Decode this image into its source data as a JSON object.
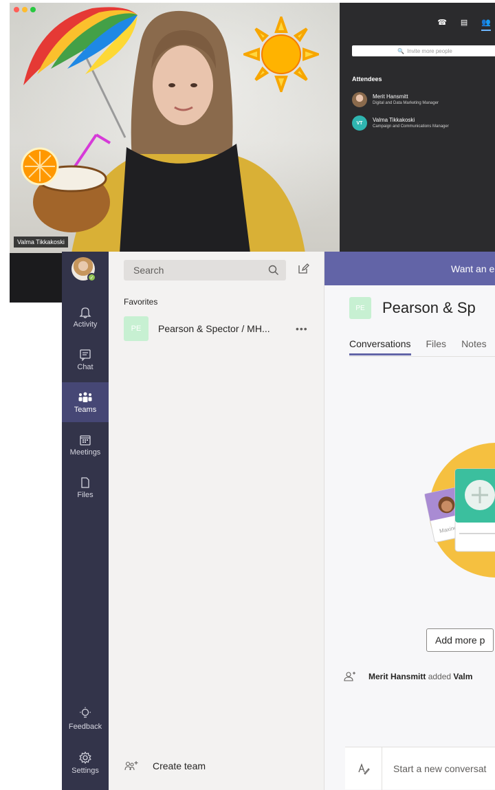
{
  "call": {
    "traffic_colors": [
      "#ff5f57",
      "#febc2e",
      "#28c840"
    ],
    "participant_name": "Valma Tikkakoski",
    "invite_placeholder": "Invite more people",
    "attendees_title": "Attendees",
    "attendees": [
      {
        "initials": "",
        "name": "Merit Hansmitt",
        "role": "Digital and Data Marketing Manager",
        "color": "#d9a07a"
      },
      {
        "initials": "VT",
        "name": "Valma Tikkakoski",
        "role": "Campaign and Communications Manager",
        "color": "#2fb5b0"
      }
    ],
    "panel_icons": [
      "phone-icon",
      "chat-icon",
      "people-icon"
    ]
  },
  "rail": {
    "items": [
      {
        "icon": "bell-icon",
        "label": "Activity",
        "active": false
      },
      {
        "icon": "chat-icon",
        "label": "Chat",
        "active": false
      },
      {
        "icon": "teams-icon",
        "label": "Teams",
        "active": true
      },
      {
        "icon": "calendar-icon",
        "label": "Meetings",
        "active": false
      },
      {
        "icon": "file-icon",
        "label": "Files",
        "active": false
      }
    ],
    "feedback_label": "Feedback",
    "settings_label": "Settings",
    "presence_color": "#92c353"
  },
  "list": {
    "search_placeholder": "Search",
    "favorites_title": "Favorites",
    "favorite": {
      "initials": "PE",
      "name": "Pearson & Spector / MH...",
      "more": "•••"
    },
    "create_team_label": "Create team"
  },
  "main": {
    "banner_text": "Want an e",
    "team_initials": "PE",
    "team_title": "Pearson & Sp",
    "tabs": [
      {
        "label": "Conversations",
        "active": true
      },
      {
        "label": "Files",
        "active": false
      },
      {
        "label": "Notes",
        "active": false
      }
    ],
    "illustration_card_name": "Maxine",
    "add_people_label": "Add more p",
    "activity_actor": "Merit Hansmitt",
    "activity_text": "added",
    "activity_target": "Valm",
    "compose_placeholder": "Start a new conversat",
    "accent_color": "#6264a7"
  }
}
